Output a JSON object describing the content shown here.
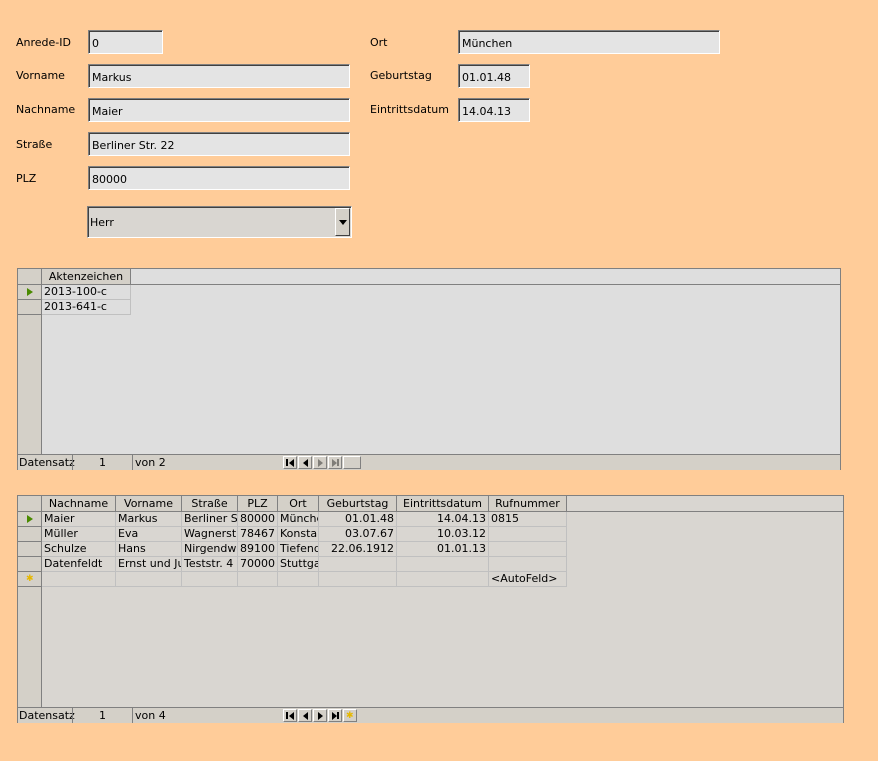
{
  "form": {
    "anrede_id": {
      "label": "Anrede-ID",
      "value": "0"
    },
    "vorname": {
      "label": "Vorname",
      "value": "Markus"
    },
    "nachname": {
      "label": "Nachname",
      "value": "Maier"
    },
    "strasse": {
      "label": "Straße",
      "value": "Berliner Str. 22"
    },
    "plz": {
      "label": "PLZ",
      "value": "80000"
    },
    "ort": {
      "label": "Ort",
      "value": "München"
    },
    "geburtstag": {
      "label": "Geburtstag",
      "value": "01.01.48"
    },
    "eintrittsdatum": {
      "label": "Eintrittsdatum",
      "value": "14.04.13"
    },
    "anrede": {
      "value": "Herr"
    }
  },
  "subform1": {
    "columns": [
      "Aktenzeichen"
    ],
    "rows": [
      "2013-100-c",
      "2013-641-c"
    ],
    "nav": {
      "label": "Datensatz",
      "current": "1",
      "total": "von 2"
    }
  },
  "subform2": {
    "columns": [
      "Nachname",
      "Vorname",
      "Straße",
      "PLZ",
      "Ort",
      "Geburtstag",
      "Eintrittsdatum",
      "Rufnummer"
    ],
    "rows": [
      [
        "Maier",
        "Markus",
        "Berliner Str",
        "80000",
        "Münche",
        "01.01.48",
        "14.04.13",
        "0815"
      ],
      [
        "Müller",
        "Eva",
        "Wagnerstr",
        "78467",
        "Konstar",
        "03.07.67",
        "10.03.12",
        ""
      ],
      [
        "Schulze",
        "Hans",
        "Nirgendwo",
        "89100",
        "Tiefend",
        "22.06.1912",
        "01.01.13",
        ""
      ],
      [
        "Datenfeldt",
        "Ernst und Jul",
        "Teststr. 4",
        "70000",
        "Stuttga",
        "",
        "",
        ""
      ]
    ],
    "new_row_placeholder": "<AutoFeld>",
    "nav": {
      "label": "Datensatz",
      "current": "1",
      "total": "von 4"
    }
  }
}
